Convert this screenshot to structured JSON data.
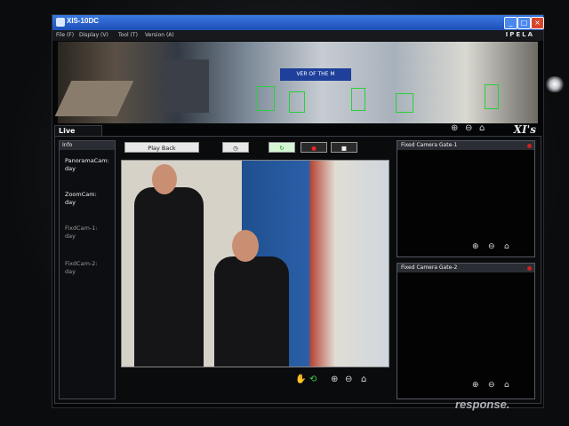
{
  "window": {
    "title": "XIS-10DC",
    "brand": "IPELA"
  },
  "menu": [
    {
      "label": "File (F)"
    },
    {
      "label": "Display (V)"
    },
    {
      "label": "Tool (T)"
    },
    {
      "label": "Version (A)"
    }
  ],
  "panorama": {
    "banner": "VER OF THE M"
  },
  "live": {
    "tab_label": "Live",
    "logo": "XI's"
  },
  "info": {
    "header": "Info",
    "items": [
      {
        "label": "PanoramaCam:",
        "value": "day",
        "active": true
      },
      {
        "label": "ZoomCam:",
        "value": "day",
        "active": true
      },
      {
        "label": "FixdCam-1:",
        "value": "day",
        "active": false
      },
      {
        "label": "FixdCam-2:",
        "value": "day",
        "active": false
      }
    ]
  },
  "toolbar": {
    "play_back": "Play Back",
    "clock_icon": "clock-icon",
    "record_icon": "record-icon",
    "stop_icon": "stop-icon"
  },
  "fixed_cams": [
    {
      "title": "Fixed Camera Gate-1"
    },
    {
      "title": "Fixed Camera Gate-2"
    }
  ],
  "watermark": "response."
}
